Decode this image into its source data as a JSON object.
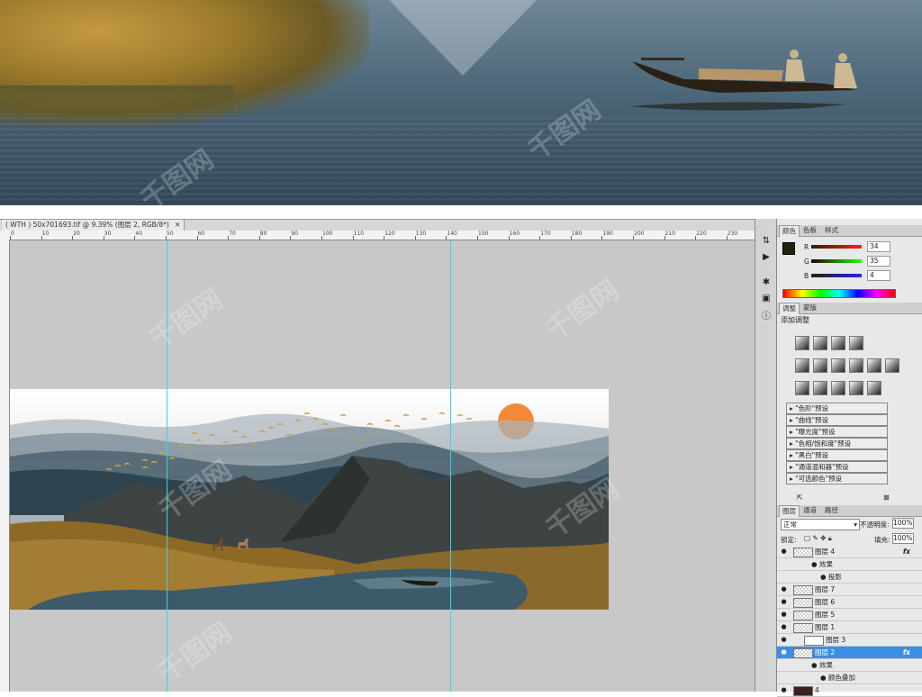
{
  "document": {
    "tab_title": "( WTH ) 50x701693.tif @ 9.39% (图层 2, RGB/8*)",
    "close_label": "✕"
  },
  "ruler": {
    "ticks": [
      "0",
      "10",
      "20",
      "30",
      "40",
      "50",
      "60",
      "70",
      "80",
      "90",
      "100",
      "110",
      "120",
      "130",
      "140",
      "150",
      "160",
      "170",
      "180",
      "190",
      "200",
      "210",
      "220",
      "230"
    ]
  },
  "color_panel": {
    "tabs": [
      "颜色",
      "色板",
      "样式"
    ],
    "r_label": "R",
    "g_label": "G",
    "b_label": "B",
    "r": "34",
    "g": "35",
    "b": "4"
  },
  "adjust_panel": {
    "tabs": [
      "调整",
      "蒙版"
    ],
    "heading": "添加调整",
    "presets": [
      "\"色阶\"预设",
      "\"曲线\"预设",
      "\"曝光度\"预设",
      "\"色相/饱和度\"预设",
      "\"黑白\"预设",
      "\"通道混和器\"预设",
      "\"可选颜色\"预设"
    ]
  },
  "layers_panel": {
    "tabs": [
      "图层",
      "通道",
      "路径"
    ],
    "blend_mode": "正常",
    "opacity_label": "不透明度:",
    "opacity": "100%",
    "lock_label": "锁定:",
    "fill_label": "填充:",
    "fill": "100%",
    "layers": [
      {
        "name": "图层 4",
        "fx": "fx",
        "kind": "layer"
      },
      {
        "name": "效果",
        "kind": "effects"
      },
      {
        "name": "投影",
        "kind": "effect"
      },
      {
        "name": "图层 7",
        "kind": "layer"
      },
      {
        "name": "图层 6",
        "kind": "layer"
      },
      {
        "name": "图层 5",
        "kind": "layer"
      },
      {
        "name": "图层 1",
        "kind": "layer"
      },
      {
        "name": "图层 3",
        "kind": "adjust"
      },
      {
        "name": "图层 2",
        "fx": "fx",
        "kind": "layer",
        "selected": true
      },
      {
        "name": "效果",
        "kind": "effects"
      },
      {
        "name": "颜色叠加",
        "kind": "effect"
      },
      {
        "name": "4",
        "kind": "layer"
      }
    ]
  },
  "watermark": "千图网",
  "colors": {
    "selection": "#3b8fe3",
    "guide": "#33d6e6",
    "sun": "#f08a3a"
  }
}
